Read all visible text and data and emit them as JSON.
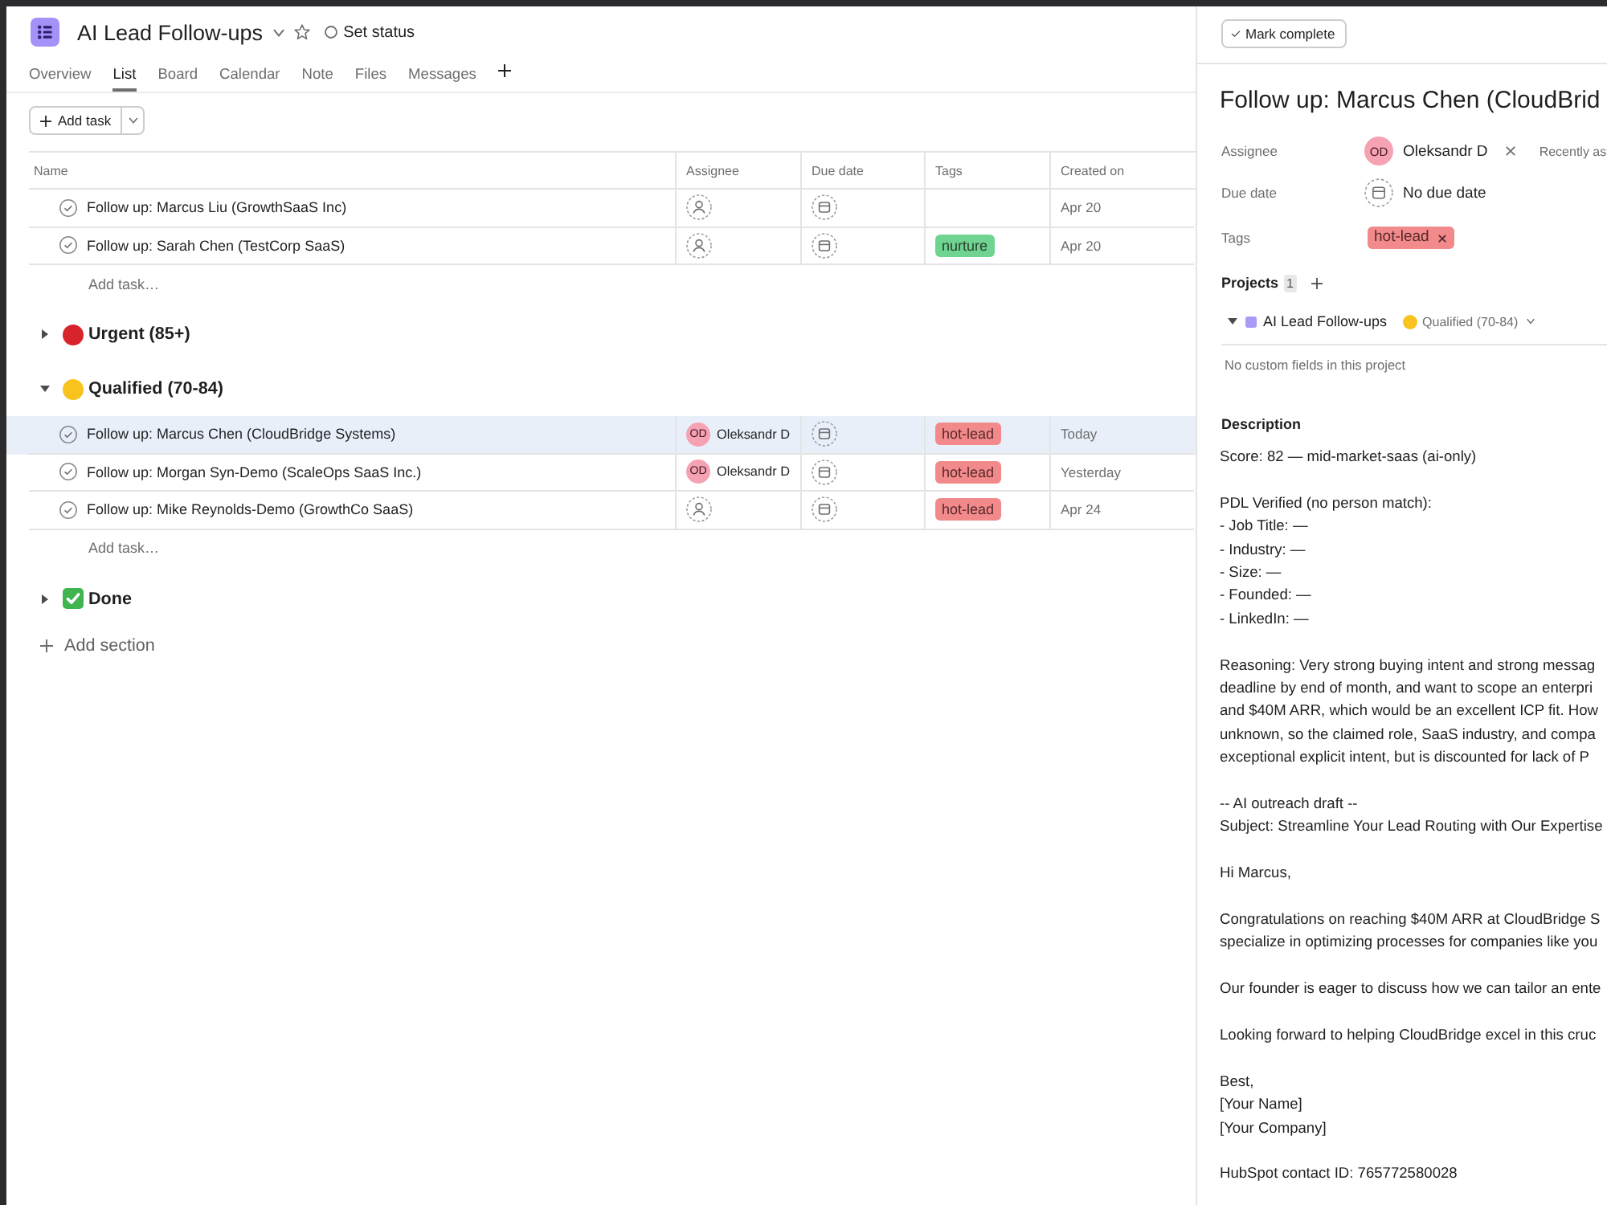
{
  "header": {
    "title": "AI Lead Follow-ups",
    "status": "Set status"
  },
  "tabs": [
    {
      "label": "Overview",
      "selected": false
    },
    {
      "label": "List",
      "selected": true
    },
    {
      "label": "Board",
      "selected": false
    },
    {
      "label": "Calendar",
      "selected": false
    },
    {
      "label": "Note",
      "selected": false
    },
    {
      "label": "Files",
      "selected": false
    },
    {
      "label": "Messages",
      "selected": false
    }
  ],
  "toolbar": {
    "add_task": "Add task"
  },
  "table": {
    "columns": [
      "Name",
      "Assignee",
      "Due date",
      "Tags",
      "Created on"
    ],
    "sections": [
      {
        "tasks": [
          {
            "name": "Follow up: Marcus Liu (GrowthSaaS Inc)",
            "completed": false,
            "selected": false,
            "created": "Apr 20"
          },
          {
            "name": "Follow up: Sarah Chen (TestCorp SaaS)",
            "completed": false,
            "selected": false,
            "tags": [
              {
                "label": "nurture",
                "color": "#6fd392"
              }
            ],
            "created": "Apr 20"
          }
        ],
        "add_task": "Add task…"
      },
      {
        "name": "Urgent (85+)",
        "kind": "dot",
        "color": "#d9232c",
        "expanded": false
      },
      {
        "name": "Qualified (70-84)",
        "kind": "dot",
        "color": "#f7c31c",
        "expanded": true,
        "tasks": [
          {
            "name": "Follow up: Marcus Chen (CloudBridge Systems)",
            "completed": false,
            "selected": true,
            "assignee": {
              "initials": "OD",
              "name": "Oleksandr D"
            },
            "tags": [
              {
                "label": "hot-lead",
                "color": "#f28a8c"
              }
            ],
            "created": "Today"
          },
          {
            "name": "Follow up: Morgan Syn-Demo (ScaleOps SaaS Inc.)",
            "completed": false,
            "selected": false,
            "assignee": {
              "initials": "OD",
              "name": "Oleksandr D"
            },
            "tags": [
              {
                "label": "hot-lead",
                "color": "#f28a8c"
              }
            ],
            "created": "Yesterday"
          },
          {
            "name": "Follow up: Mike Reynolds-Demo (GrowthCo SaaS)",
            "completed": false,
            "selected": false,
            "tags": [
              {
                "label": "hot-lead",
                "color": "#f28a8c"
              }
            ],
            "created": "Apr 24"
          }
        ],
        "add_task": "Add task…"
      },
      {
        "name": "Done",
        "kind": "check",
        "color": "#3fb44f",
        "expanded": false
      }
    ],
    "add_section": "Add section"
  },
  "detail": {
    "mark_complete": "Mark complete",
    "title": "Follow up: Marcus Chen (CloudBrid",
    "fields": [
      {
        "kind": "person",
        "label": "Assignee",
        "initials": "OD",
        "value": "Oleksandr D",
        "note": "Recently as"
      },
      {
        "kind": "date",
        "label": "Due date",
        "value": "No due date"
      },
      {
        "kind": "tags",
        "label": "Tags",
        "tags": [
          {
            "label": "hot-lead",
            "color": "#f28a8c"
          }
        ]
      }
    ],
    "projects": {
      "label": "Projects",
      "count": "1",
      "items": [
        {
          "name": "AI Lead Follow-ups",
          "color": "#a99af5",
          "expanded": true,
          "section": {
            "name": "Qualified (70-84)",
            "color": "#f7c31c"
          }
        }
      ]
    },
    "custom_fields_note": "No custom fields in this project",
    "description": {
      "heading": "Description",
      "paragraphs": [
        [
          "Score: 82 — mid-market-saas (ai-only)"
        ],
        [
          "PDL Verified (no person match):",
          "- Job Title: —",
          "- Industry: —",
          "- Size: —",
          "- Founded: —",
          "- LinkedIn: —"
        ],
        [
          "Reasoning: Very strong buying intent and strong messag",
          "deadline by end of month, and want to scope an enterpri",
          "and $40M ARR, which would be an excellent ICP fit. How",
          "unknown, so the claimed role, SaaS industry, and compa",
          "exceptional explicit intent, but is discounted for lack of P"
        ],
        [
          "-- AI outreach draft --",
          "Subject: Streamline Your Lead Routing with Our Expertise"
        ],
        [
          "Hi Marcus,"
        ],
        [
          "Congratulations on reaching $40M ARR at CloudBridge S",
          "specialize in optimizing processes for companies like you"
        ],
        [
          "Our founder is eager to discuss how we can tailor an ente"
        ],
        [
          "Looking forward to helping CloudBridge excel in this cruc"
        ],
        [
          "Best,",
          "[Your Name]",
          "[Your Company]"
        ],
        [
          "HubSpot contact ID: 765772580028"
        ]
      ]
    }
  }
}
